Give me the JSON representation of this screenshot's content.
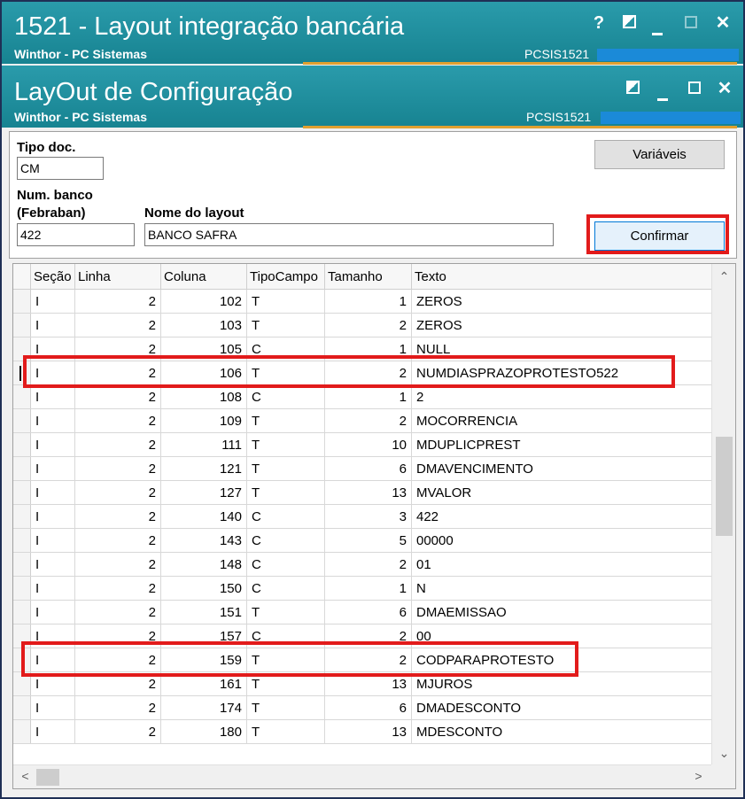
{
  "window1": {
    "title": "1521 - Layout integração bancária",
    "subtitle": "Winthor - PC Sistemas",
    "code": "PCSIS1521",
    "help": "?"
  },
  "window2": {
    "title": "LayOut de Configuração",
    "subtitle": "Winthor - PC Sistemas",
    "code": "PCSIS1521"
  },
  "form": {
    "tipo_doc_label": "Tipo doc.",
    "tipo_doc_value": "CM",
    "num_banco_label_1": "Num. banco",
    "num_banco_label_2": "(Febraban)",
    "num_banco_value": "422",
    "nome_layout_label": "Nome do layout",
    "nome_layout_value": "BANCO SAFRA",
    "variaveis_label": "Variáveis",
    "confirmar_label": "Confirmar"
  },
  "table": {
    "columns": [
      "Seção",
      "Linha",
      "Coluna",
      "TipoCampo",
      "Tamanho",
      "Texto"
    ],
    "rows": [
      [
        "I",
        "2",
        "102",
        "T",
        "1",
        "ZEROS"
      ],
      [
        "I",
        "2",
        "103",
        "T",
        "2",
        "ZEROS"
      ],
      [
        "I",
        "2",
        "105",
        "C",
        "1",
        "NULL"
      ],
      [
        "I",
        "2",
        "106",
        "T",
        "2",
        "NUMDIASPRAZOPROTESTO522"
      ],
      [
        "I",
        "2",
        "108",
        "C",
        "1",
        "2"
      ],
      [
        "I",
        "2",
        "109",
        "T",
        "2",
        "MOCORRENCIA"
      ],
      [
        "I",
        "2",
        "111",
        "T",
        "10",
        "MDUPLICPREST"
      ],
      [
        "I",
        "2",
        "121",
        "T",
        "6",
        "DMAVENCIMENTO"
      ],
      [
        "I",
        "2",
        "127",
        "T",
        "13",
        "MVALOR"
      ],
      [
        "I",
        "2",
        "140",
        "C",
        "3",
        "422"
      ],
      [
        "I",
        "2",
        "143",
        "C",
        "5",
        "00000"
      ],
      [
        "I",
        "2",
        "148",
        "C",
        "2",
        "01"
      ],
      [
        "I",
        "2",
        "150",
        "C",
        "1",
        "N"
      ],
      [
        "I",
        "2",
        "151",
        "T",
        "6",
        "DMAEMISSAO"
      ],
      [
        "I",
        "2",
        "157",
        "C",
        "2",
        "00"
      ],
      [
        "I",
        "2",
        "159",
        "T",
        "2",
        "CODPARAPROTESTO"
      ],
      [
        "I",
        "2",
        "161",
        "T",
        "13",
        "MJUROS"
      ],
      [
        "I",
        "2",
        "174",
        "T",
        "6",
        "DMADESCONTO"
      ],
      [
        "I",
        "2",
        "180",
        "T",
        "13",
        "MDESCONTO"
      ]
    ],
    "current_row_index": 3
  },
  "colors": {
    "titlebar": "#1d8a9a",
    "highlight": "#e21b1b",
    "accent_line": "#e0a030",
    "strip": "#1b8ad8"
  },
  "icons": [
    "help-icon",
    "restore-icon",
    "minimize-icon",
    "maximize-icon",
    "close-icon",
    "chevron-up-icon",
    "chevron-down-icon",
    "chevron-left-icon",
    "chevron-right-icon"
  ]
}
